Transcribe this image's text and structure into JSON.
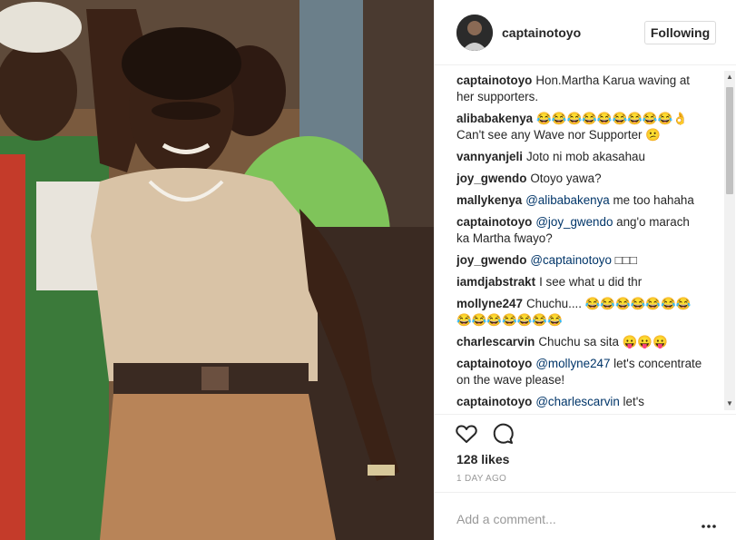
{
  "post": {
    "username": "captainotoyo",
    "follow_label": "Following"
  },
  "comments": [
    {
      "user": "captainotoyo",
      "text": "Hon.Martha Karua waving at her supporters."
    },
    {
      "user": "alibabakenya",
      "text": "😂😂😂😂😂😂😂😂😂👌 Can't see any Wave nor Supporter 😕"
    },
    {
      "user": "vannyanjeli",
      "text": "Joto ni mob akasahau"
    },
    {
      "user": "joy_gwendo",
      "text": "Otoyo yawa?"
    },
    {
      "user": "mallykenya",
      "mention": "@alibabakenya",
      "text": "me too hahaha"
    },
    {
      "user": "captainotoyo",
      "mention": "@joy_gwendo",
      "text": "ang'o marach ka Martha fwayo?"
    },
    {
      "user": "joy_gwendo",
      "mention": "@captainotoyo",
      "text": "□□□"
    },
    {
      "user": "iamdjabstrakt",
      "text": "I see what u did thr"
    },
    {
      "user": "mollyne247",
      "text": "Chuchu.... 😂😂😂😂😂😂😂😂😂😂😂😂😂😂"
    },
    {
      "user": "charlescarvin",
      "text": "Chuchu sa sita 😛😛😛"
    },
    {
      "user": "captainotoyo",
      "mention": "@mollyne247",
      "text": "let's concentrate on the wave please!"
    },
    {
      "user": "captainotoyo",
      "mention": "@charlescarvin",
      "text": "let's"
    }
  ],
  "actions": {
    "like_icon": "heart-icon",
    "comment_icon": "speech-bubble-icon",
    "more_icon": "ellipsis-icon"
  },
  "likes_label": "128 likes",
  "time_label": "1 DAY AGO",
  "add_comment_placeholder": "Add a comment...",
  "colors": {
    "text": "#262626",
    "muted": "#999999",
    "mention": "#003569",
    "border": "#efefef"
  }
}
